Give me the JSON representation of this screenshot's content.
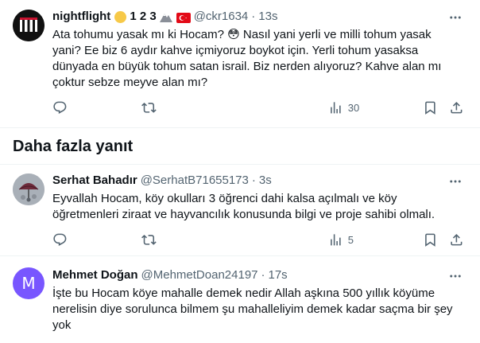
{
  "tweet1": {
    "name": "nightflight",
    "name_suffix": "1 2 3",
    "handle": "@ckr1634",
    "dot": "·",
    "time": "13s",
    "lines": [
      "Ata tohumu yasak mı ki Hocam? 😳 Nasıl yani yerli ve milli tohum yasak",
      "yani? Ee biz 6 aydır kahve içmiyoruz boykot için. Yerli tohum yasaksa",
      "dünyada en büyük tohum satan israil. Biz nerden alıyoruz? Kahve alan mı",
      "çoktur sebze meyve alan mı?"
    ],
    "views": "30"
  },
  "section_title": "Daha fazla yanıt",
  "tweet2": {
    "name": "Serhat Bahadır",
    "handle": "@SerhatB71655173",
    "dot": "·",
    "time": "3s",
    "lines": [
      "Eyvallah Hocam, köy okulları 3 öğrenci dahi kalsa açılmalı ve köy",
      "öğretmenleri ziraat ve hayvancılık konusunda bilgi ve proje sahibi olmalı."
    ],
    "views": "5"
  },
  "tweet3": {
    "name": "Mehmet Doğan",
    "handle": "@MehmetDoan24197",
    "dot": "·",
    "time": "17s",
    "avatar_letter": "M",
    "lines": [
      "İşte bu Hocam köye mahalle demek nedir Allah aşkına 500 yıllık köyüme",
      "nerelisin diye sorulunca bilmem şu mahalleliyim demek kadar saçma bir şey",
      "yok"
    ]
  },
  "colors": {
    "text": "#0f1419",
    "muted": "#536471",
    "divider": "#eff3f4",
    "avatar_m": "#7856ff"
  }
}
